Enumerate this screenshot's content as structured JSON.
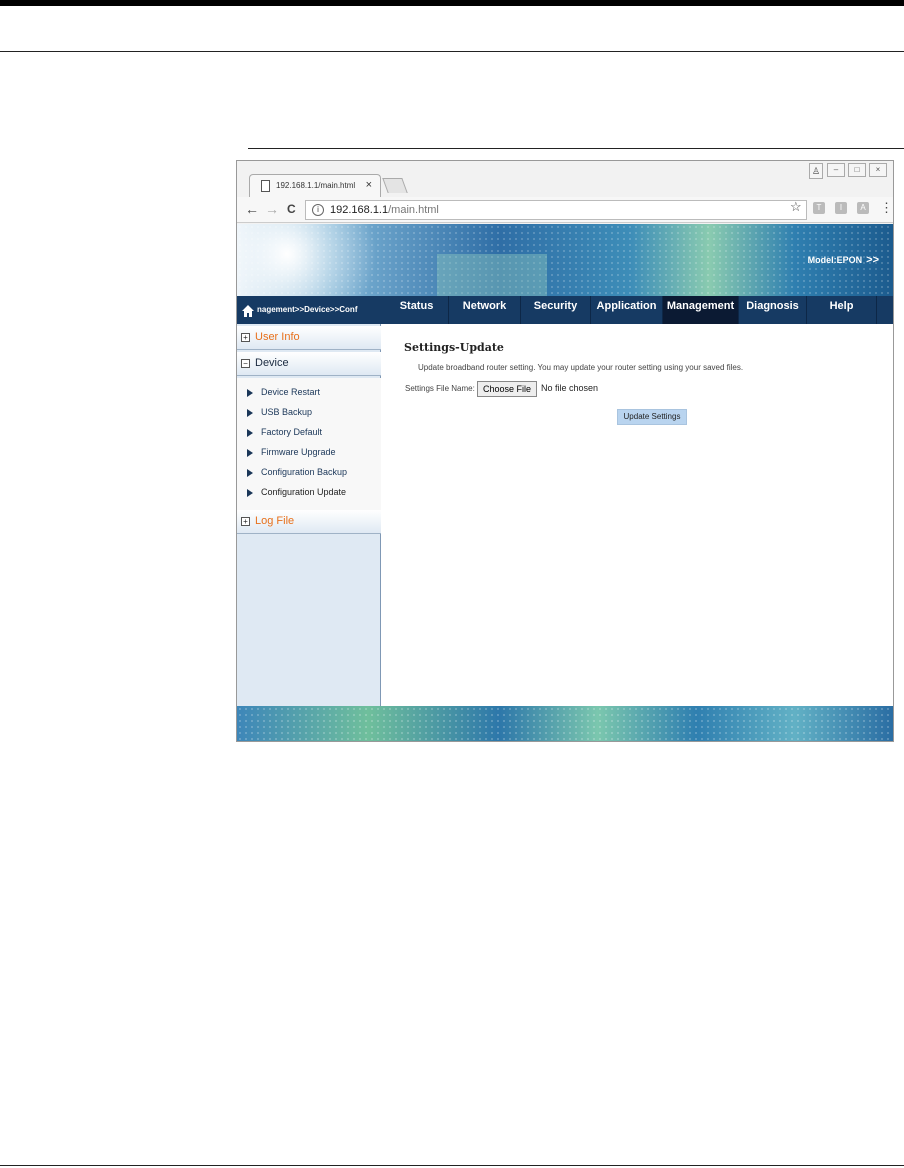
{
  "browser": {
    "tab_title": "192.168.1.1/main.html",
    "tab_close": "×",
    "url_host": "192.168.1.1",
    "url_path": "/main.html",
    "back": "←",
    "forward": "→",
    "reload": "C",
    "info": "i",
    "star": "☆",
    "ext1": "T",
    "ext2": "I",
    "ext3": "A",
    "menu": "⋮",
    "win_min": "–",
    "win_max": "□",
    "win_close": "×",
    "profile": "♙"
  },
  "router": {
    "model_label": "Model:EPON",
    "model_arrow": ">>",
    "breadcrumb": "nagement>>Device>>Conf",
    "menu": [
      {
        "label": "Status",
        "active": false
      },
      {
        "label": "Network",
        "active": false
      },
      {
        "label": "Security",
        "active": false
      },
      {
        "label": "Application",
        "active": false
      },
      {
        "label": "Management",
        "active": true
      },
      {
        "label": "Diagnosis",
        "active": false
      },
      {
        "label": "Help",
        "active": false
      }
    ],
    "sidebar": {
      "user_info": {
        "label": "User Info",
        "toggle": "+"
      },
      "device": {
        "label": "Device",
        "toggle": "−"
      },
      "device_items": [
        "Device Restart",
        "USB Backup",
        "Factory Default",
        "Firmware Upgrade",
        "Configuration Backup",
        "Configuration Update"
      ],
      "log_file": {
        "label": "Log File",
        "toggle": "+"
      }
    },
    "content": {
      "heading": "Settings-Update",
      "description": "Update broadband router setting. You may update your router setting using your saved files.",
      "file_label": "Settings File Name:",
      "choose_file": "Choose File",
      "no_file": "No file chosen",
      "update_button": "Update Settings"
    }
  }
}
